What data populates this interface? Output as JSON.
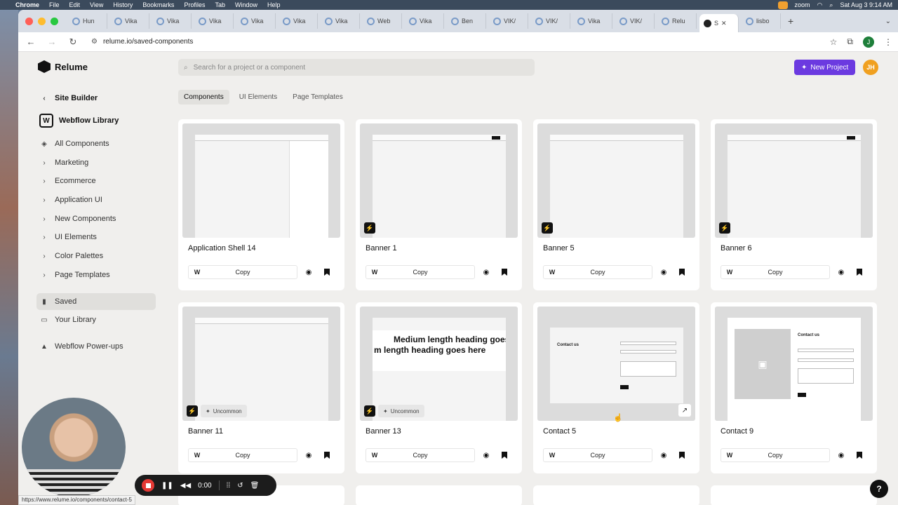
{
  "menubar": {
    "app": "Chrome",
    "items": [
      "File",
      "Edit",
      "View",
      "History",
      "Bookmarks",
      "Profiles",
      "Tab",
      "Window",
      "Help"
    ],
    "zoom": "zoom",
    "datetime": "Sat Aug 3  9:14 AM"
  },
  "browser": {
    "tabs": [
      {
        "label": "Hun"
      },
      {
        "label": "Vika"
      },
      {
        "label": "Vika"
      },
      {
        "label": "Vika"
      },
      {
        "label": "Vika"
      },
      {
        "label": "Vika"
      },
      {
        "label": "Vika"
      },
      {
        "label": "Web"
      },
      {
        "label": "Vika"
      },
      {
        "label": "Ben"
      },
      {
        "label": "VIK/"
      },
      {
        "label": "VIK/"
      },
      {
        "label": "Vika"
      },
      {
        "label": "VIK/"
      },
      {
        "label": "Relu"
      },
      {
        "label": "S"
      },
      {
        "label": "lisbo"
      }
    ],
    "url": "relume.io/saved-components",
    "profile_initial": "J"
  },
  "app": {
    "brand": "Relume",
    "search_placeholder": "Search for a project or a component",
    "new_project": "New Project",
    "user_initials": "JH"
  },
  "sidebar": {
    "back": "Site Builder",
    "library": "Webflow Library",
    "items": [
      {
        "label": "All Components"
      },
      {
        "label": "Marketing"
      },
      {
        "label": "Ecommerce"
      },
      {
        "label": "Application UI"
      },
      {
        "label": "New Components"
      },
      {
        "label": "UI Elements"
      },
      {
        "label": "Color Palettes"
      },
      {
        "label": "Page Templates"
      },
      {
        "label": "Saved"
      },
      {
        "label": "Your Library"
      },
      {
        "label": "Webflow Power-ups"
      }
    ]
  },
  "page_tabs": [
    "Components",
    "UI Elements",
    "Page Templates"
  ],
  "cards": [
    {
      "title": "Application Shell 14",
      "copy": "Copy"
    },
    {
      "title": "Banner 1",
      "copy": "Copy"
    },
    {
      "title": "Banner 5",
      "copy": "Copy"
    },
    {
      "title": "Banner 6",
      "copy": "Copy"
    },
    {
      "title": "Banner 11",
      "copy": "Copy",
      "badge": "Uncommon"
    },
    {
      "title": "Banner 13",
      "copy": "Copy",
      "badge": "Uncommon",
      "thumb_text": [
        "Medium length heading goes",
        "m length heading goes here"
      ]
    },
    {
      "title": "Contact 5",
      "copy": "Copy",
      "thumb_heading": "Contact us"
    },
    {
      "title": "Contact 9",
      "copy": "Copy",
      "thumb_heading": "Contact us"
    }
  ],
  "recorder": {
    "time": "0:00"
  },
  "status_url": "https://www.relume.io/components/contact-5",
  "help": "?"
}
